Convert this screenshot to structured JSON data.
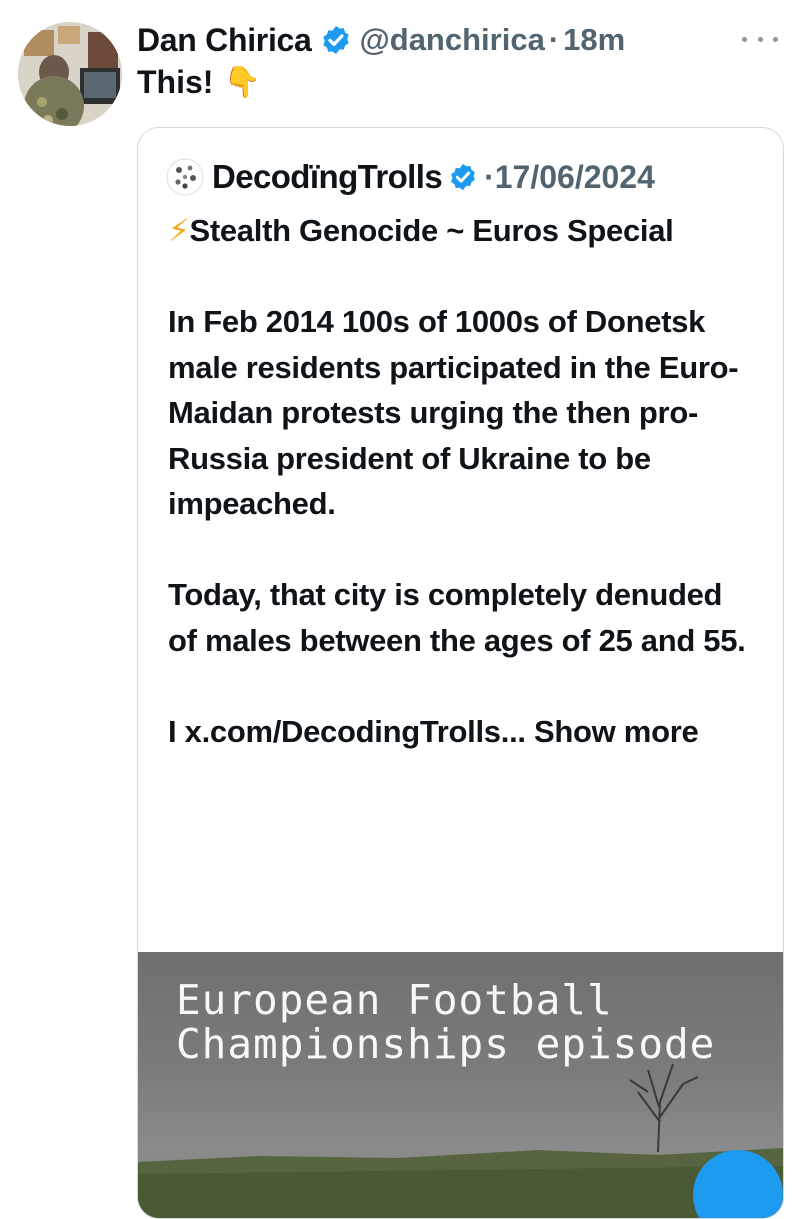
{
  "tweet": {
    "author_name": "Dan Chirica",
    "handle": "@danchirica",
    "separator": "·",
    "time": "18m",
    "text": "This!",
    "emoji": "👇"
  },
  "quoted": {
    "author_name": "DecodїngTrolls",
    "separator": "·",
    "date": "17/06/2024",
    "bolt": "⚡",
    "headline": "Stealth Genocide ~ Euros Special",
    "paragraph1": "In Feb 2014 100s of 1000s of Donetsk male residents participated in the Euro-Maidan protests urging the then pro-Russia president of Ukraine to be impeached.",
    "paragraph2": "Today, that city is completely denuded of males between the ages of 25 and 55.",
    "paragraph3": "I x.com/DecodingTrolls...",
    "show_more": "Show more",
    "media_caption": "European Football Championships episode"
  },
  "colors": {
    "verified": "#1d9bf0",
    "muted": "#536471",
    "border": "#cfd9de",
    "fab": "#1d9bf0"
  }
}
